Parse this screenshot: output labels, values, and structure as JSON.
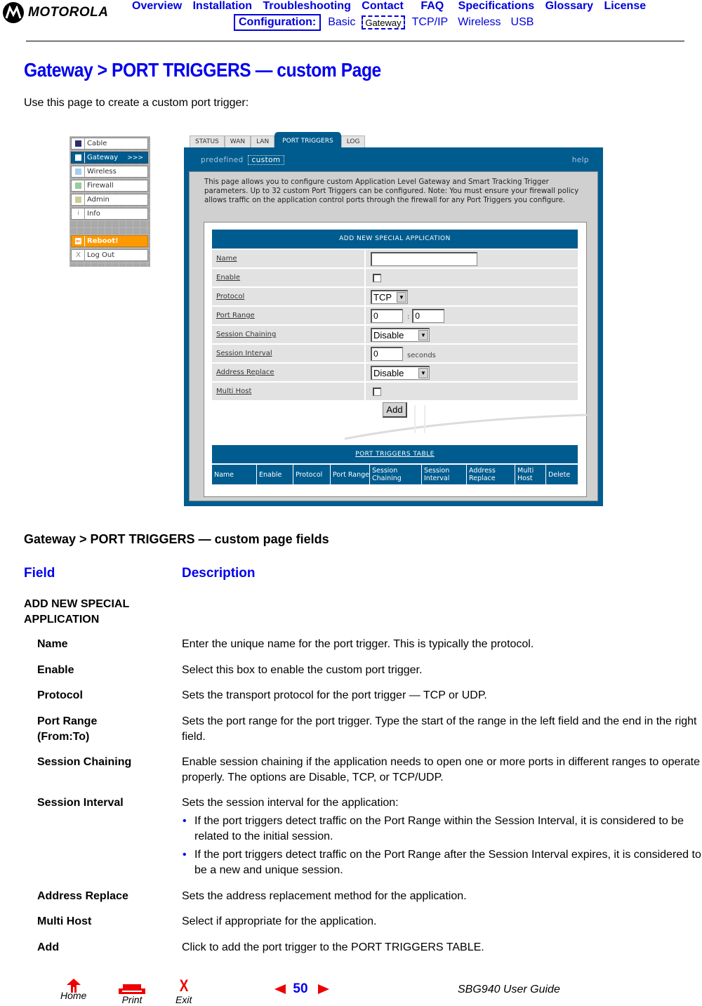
{
  "header": {
    "brand": "MOTOROLA",
    "top_nav": [
      "Overview",
      "Installation",
      "Troubleshooting",
      "Contact",
      "FAQ",
      "Specifications",
      "Glossary",
      "License"
    ],
    "config_label": "Configuration:",
    "sub_nav": [
      "Basic",
      "Gateway",
      "TCP/IP",
      "Wireless",
      "USB"
    ],
    "sub_nav_selected": "Gateway"
  },
  "page": {
    "title": "Gateway > PORT TRIGGERS — custom Page",
    "intro": "Use this page to create a custom port trigger:"
  },
  "router_ui": {
    "sidebar": [
      {
        "label": "Cable",
        "icon": "cable-square-icon",
        "color": "#2d2d6b"
      },
      {
        "label": "Gateway",
        "icon": "gateway-square-icon",
        "color": "#ffffff",
        "active": true,
        "suffix": ">>>"
      },
      {
        "label": "Wireless",
        "icon": "wireless-square-icon",
        "color": "#a6cdf0"
      },
      {
        "label": "Firewall",
        "icon": "firewall-square-icon",
        "color": "#99cc99"
      },
      {
        "label": "Admin",
        "icon": "admin-square-icon",
        "color": "#cccc99"
      },
      {
        "label": "Info",
        "icon": "info-icon",
        "glyph": "i"
      },
      {
        "label": "Reboot!",
        "icon": "reboot-arrow-icon",
        "glyph": "⇐"
      },
      {
        "label": "Log Out",
        "icon": "logout-x-icon",
        "glyph": "X"
      }
    ],
    "tabs": [
      "STATUS",
      "WAN",
      "LAN",
      "PORT TRIGGERS",
      "LOG"
    ],
    "active_tab": "PORT TRIGGERS",
    "subtabs": {
      "predefined": "predefined",
      "custom": "custom",
      "help": "help"
    },
    "description": "This page allows you to configure custom Application Level Gateway and Smart Tracking Trigger parameters. Up to 32 custom Port Triggers can be configured. Note: You must ensure your firewall policy allows traffic on the application control ports through the firewall for any Port Triggers you configure.",
    "form": {
      "header": "ADD NEW SPECIAL APPLICATION",
      "name_label": "Name",
      "name_value": "",
      "enable_label": "Enable",
      "enable_checked": false,
      "protocol_label": "Protocol",
      "protocol_value": "TCP",
      "port_range_label": "Port Range",
      "port_from": "0",
      "port_sep": ":",
      "port_to": "0",
      "session_chaining_label": "Session Chaining",
      "session_chaining_value": "Disable",
      "session_interval_label": "Session Interval",
      "session_interval_value": "0",
      "session_interval_unit": "seconds",
      "address_replace_label": "Address Replace",
      "address_replace_value": "Disable",
      "multi_host_label": "Multi Host",
      "multi_host_checked": false,
      "add_button": "Add"
    },
    "triggers_table": {
      "header": "PORT TRIGGERS TABLE",
      "columns": [
        "Name",
        "Enable",
        "Protocol",
        "Port Range",
        "Session Chaining",
        "Session Interval",
        "Address Replace",
        "Multi Host",
        "Delete"
      ]
    }
  },
  "fields_table": {
    "title": "Gateway > PORT TRIGGERS — custom page fields",
    "col_field": "Field",
    "col_description": "Description",
    "section": "ADD NEW SPECIAL APPLICATION",
    "rows": [
      {
        "field": "Name",
        "description": "Enter the unique name for the port trigger. This is typically the protocol."
      },
      {
        "field": "Enable",
        "description": "Select this box to enable the custom port trigger."
      },
      {
        "field": "Protocol",
        "description": "Sets the transport protocol for the port trigger — TCP or UDP."
      },
      {
        "field": "Port Range (From:To)",
        "description": "Sets the port range for the port trigger. Type the start of the range in the left field and the end in the right field."
      },
      {
        "field": "Session Chaining",
        "description": "Enable session chaining if the application needs to open one or more ports in different ranges to operate properly. The options are Disable, TCP, or TCP/UDP."
      },
      {
        "field": "Session Interval",
        "description": "Sets the session interval for the application:",
        "bullets": [
          "If the port triggers detect traffic on the Port Range within the Session Interval, it is considered to be related to the initial session.",
          "If the port triggers detect traffic on the Port Range after the Session Interval expires, it is considered to be a new and unique session."
        ]
      },
      {
        "field": "Address Replace",
        "description": "Sets the address replacement method for the application."
      },
      {
        "field": "Multi Host",
        "description": "Select if appropriate for the application."
      },
      {
        "field": "Add",
        "description": "Click to add the port trigger to the PORT TRIGGERS TABLE."
      }
    ]
  },
  "footer": {
    "home": "Home",
    "print": "Print",
    "exit": "Exit",
    "page_number": "50",
    "guide_title": "SBG940 User Guide"
  },
  "colors": {
    "link_blue": "#0000ee",
    "router_blue": "#005c8f",
    "reboot_orange": "#ff9900",
    "footer_red": "#ee0000"
  }
}
